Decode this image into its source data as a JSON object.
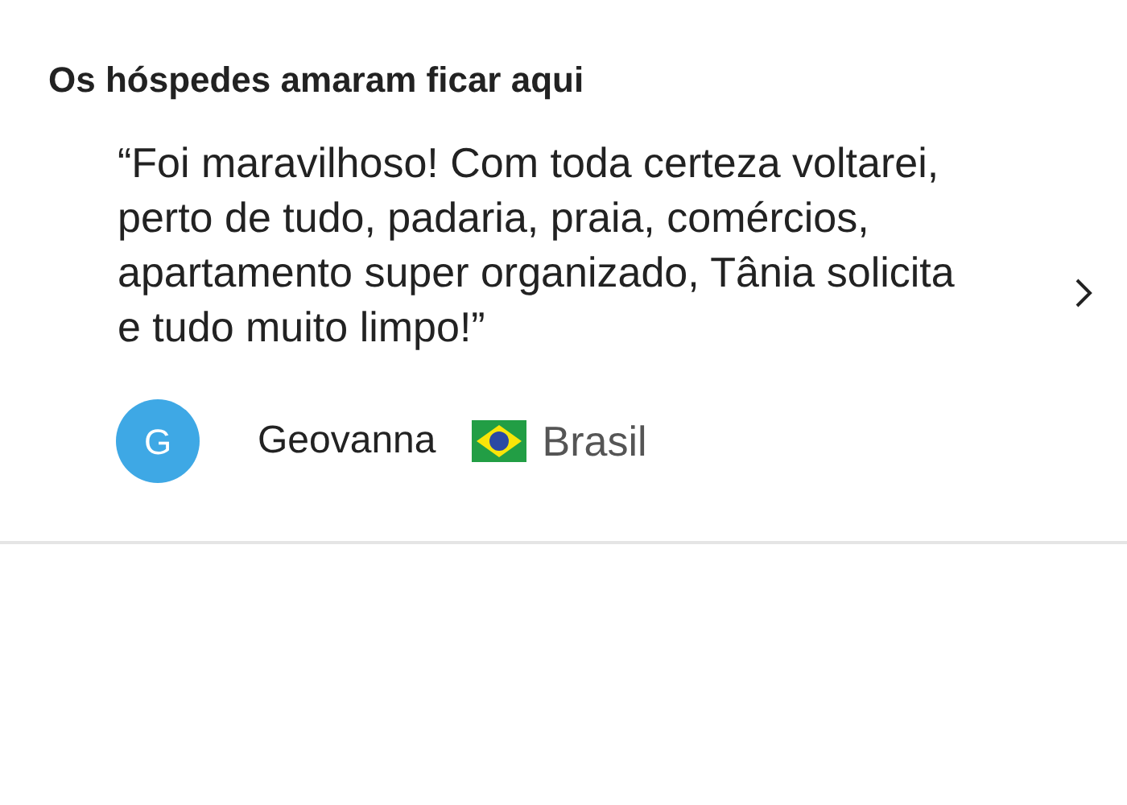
{
  "section": {
    "title": "Os hóspedes amaram ficar aqui"
  },
  "review": {
    "text": "“Foi maravilhoso! Com toda certeza voltarei, perto de tudo, padaria, praia, comércios, apartamento super organizado, Tânia solicita e tudo muito limpo!”",
    "author": {
      "initial": "G",
      "name": "Geovanna",
      "country": "Brasil"
    }
  }
}
